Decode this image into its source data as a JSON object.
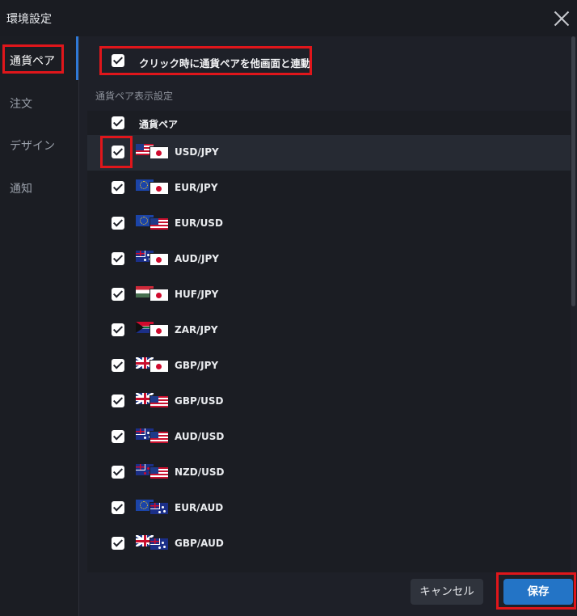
{
  "window": {
    "title": "環境設定"
  },
  "sidebar": {
    "items": [
      {
        "label": "通貨ペア",
        "active": true
      },
      {
        "label": "注文",
        "active": false
      },
      {
        "label": "デザイン",
        "active": false
      },
      {
        "label": "通知",
        "active": false
      }
    ]
  },
  "sync_option": {
    "label": "クリック時に通貨ペアを他画面と連動",
    "checked": true
  },
  "section": {
    "title": "通貨ペア表示設定"
  },
  "list": {
    "header_label": "通貨ペア",
    "header_checked": true,
    "rows": [
      {
        "pair": "USD/JPY",
        "checked": true,
        "flags": [
          "us",
          "jp"
        ]
      },
      {
        "pair": "EUR/JPY",
        "checked": true,
        "flags": [
          "eu",
          "jp"
        ]
      },
      {
        "pair": "EUR/USD",
        "checked": true,
        "flags": [
          "eu",
          "us"
        ]
      },
      {
        "pair": "AUD/JPY",
        "checked": true,
        "flags": [
          "au",
          "jp"
        ]
      },
      {
        "pair": "HUF/JPY",
        "checked": true,
        "flags": [
          "hu",
          "jp"
        ]
      },
      {
        "pair": "ZAR/JPY",
        "checked": true,
        "flags": [
          "za",
          "jp"
        ]
      },
      {
        "pair": "GBP/JPY",
        "checked": true,
        "flags": [
          "gb",
          "jp"
        ]
      },
      {
        "pair": "GBP/USD",
        "checked": true,
        "flags": [
          "gb",
          "us"
        ]
      },
      {
        "pair": "AUD/USD",
        "checked": true,
        "flags": [
          "au",
          "us"
        ]
      },
      {
        "pair": "NZD/USD",
        "checked": true,
        "flags": [
          "nz",
          "us"
        ]
      },
      {
        "pair": "EUR/AUD",
        "checked": true,
        "flags": [
          "eu",
          "au"
        ]
      },
      {
        "pair": "GBP/AUD",
        "checked": true,
        "flags": [
          "gb",
          "au"
        ]
      }
    ]
  },
  "buttons": {
    "cancel": "キャンセル",
    "save": "保存"
  },
  "colors": {
    "accent": "#2374c6",
    "highlight": "#e0161b",
    "background": "#1e2028"
  }
}
